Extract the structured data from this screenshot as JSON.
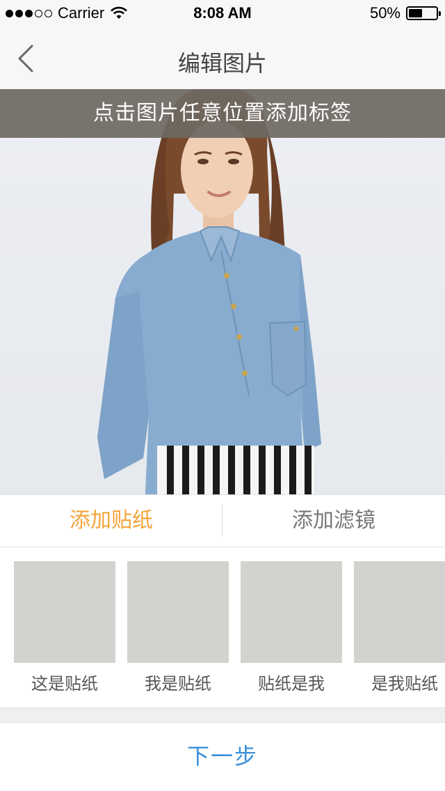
{
  "status_bar": {
    "carrier": "Carrier",
    "time": "8:08 AM",
    "battery": "50%",
    "battery_level": 0.5,
    "signal_bars_filled": 3,
    "signal_bars_total": 5
  },
  "nav": {
    "title": "编辑图片",
    "back_icon": "chevron-left-icon"
  },
  "photo": {
    "tip": "点击图片任意位置添加标签"
  },
  "tabs": [
    {
      "label": "添加贴纸",
      "active": true
    },
    {
      "label": "添加滤镜",
      "active": false
    }
  ],
  "stickers": [
    {
      "label": "这是贴纸"
    },
    {
      "label": "我是贴纸"
    },
    {
      "label": "贴纸是我"
    },
    {
      "label": "是我贴纸"
    }
  ],
  "footer": {
    "next_label": "下一步"
  },
  "colors": {
    "accent_orange": "#f5a33a",
    "link_blue": "#3a8fd8",
    "banner_overlay": "#6e6862"
  }
}
